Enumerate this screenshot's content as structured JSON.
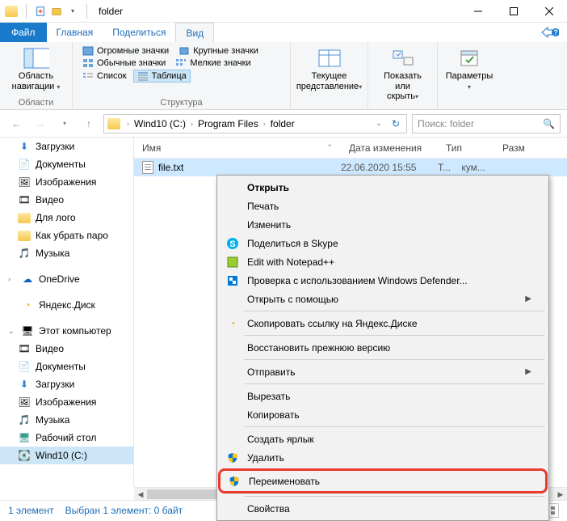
{
  "titlebar": {
    "title": "folder"
  },
  "tabs": {
    "file": "Файл",
    "home": "Главная",
    "share": "Поделиться",
    "view": "Вид"
  },
  "ribbon": {
    "navpane": {
      "label": "Область\nнавигации",
      "group": "Области"
    },
    "layouts": {
      "xl": "Огромные значки",
      "lg": "Крупные значки",
      "md": "Обычные значки",
      "sm": "Мелкие значки",
      "list": "Список",
      "table": "Таблица",
      "group": "Структура"
    },
    "curview": {
      "label": "Текущее\nпредставление",
      "group": ""
    },
    "showhide": {
      "label": "Показать\nили скрыть"
    },
    "options": {
      "label": "Параметры"
    }
  },
  "breadcrumb": {
    "drive": "Wind10 (C:)",
    "p1": "Program Files",
    "p2": "folder"
  },
  "search": {
    "placeholder": "Поиск: folder"
  },
  "nav": {
    "downloads": "Загрузки",
    "documents": "Документы",
    "pictures": "Изображения",
    "video": "Видео",
    "logo": "Для лого",
    "howto": "Как убрать паро",
    "music": "Музыка",
    "onedrive": "OneDrive",
    "yadisk": "Яндекс.Диск",
    "thispc": "Этот компьютер",
    "video2": "Видео",
    "documents2": "Документы",
    "downloads2": "Загрузки",
    "pictures2": "Изображения",
    "music2": "Музыка",
    "desktop": "Рабочий стол",
    "cdrive": "Wind10 (C:)"
  },
  "cols": {
    "name": "Имя",
    "date": "Дата изменения",
    "type": "Тип",
    "size": "Разм"
  },
  "file": {
    "name": "file.txt",
    "date": "22.06.2020 15:55",
    "type": "Т...",
    "type2": "кум..."
  },
  "ctx": {
    "open": "Открыть",
    "print": "Печать",
    "edit": "Изменить",
    "skype": "Поделиться в Skype",
    "notepadpp": "Edit with Notepad++",
    "defender": "Проверка с использованием Windows Defender...",
    "openwith": "Открыть с помощью",
    "yadisk": "Скопировать ссылку на Яндекс.Диске",
    "restore": "Восстановить прежнюю версию",
    "sendto": "Отправить",
    "cut": "Вырезать",
    "copy": "Копировать",
    "shortcut": "Создать ярлык",
    "delete": "Удалить",
    "rename": "Переименовать",
    "props": "Свойства"
  },
  "status": {
    "count": "1 элемент",
    "sel": "Выбран 1 элемент: 0 байт"
  }
}
